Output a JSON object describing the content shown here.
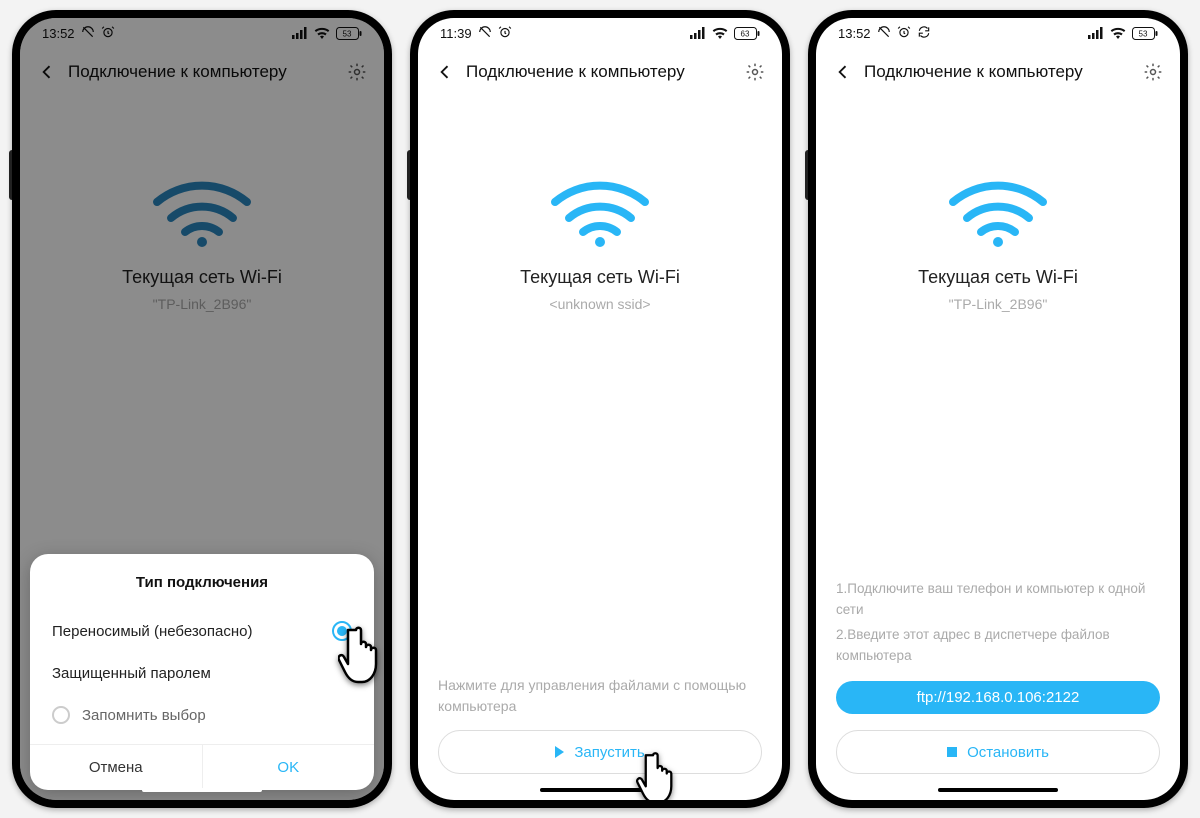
{
  "phones": [
    {
      "status": {
        "time": "13:52",
        "battery": "53"
      },
      "header": {
        "title": "Подключение к компьютеру"
      },
      "network": {
        "title": "Текущая сеть Wi-Fi",
        "ssid": "\"TP-Link_2B96\""
      },
      "sheet": {
        "title": "Тип подключения",
        "opt1": "Переносимый (небезопасно)",
        "opt2": "Защищенный паролем",
        "remember": "Запомнить выбор",
        "cancel": "Отмена",
        "ok": "OK"
      }
    },
    {
      "status": {
        "time": "11:39",
        "battery": "63"
      },
      "header": {
        "title": "Подключение к компьютеру"
      },
      "network": {
        "title": "Текущая сеть Wi-Fi",
        "ssid": "<unknown ssid>"
      },
      "hint": "Нажмите для управления файлами с помощью компьютера",
      "button": "Запустить"
    },
    {
      "status": {
        "time": "13:52",
        "battery": "53"
      },
      "header": {
        "title": "Подключение к компьютеру"
      },
      "network": {
        "title": "Текущая сеть Wi-Fi",
        "ssid": "\"TP-Link_2B96\""
      },
      "instr1": "1.Подключите ваш телефон и компьютер к одной сети",
      "instr2": "2.Введите этот адрес в диспетчере файлов компьютера",
      "ftp": "ftp://192.168.0.106:2122",
      "button": "Остановить"
    }
  ]
}
